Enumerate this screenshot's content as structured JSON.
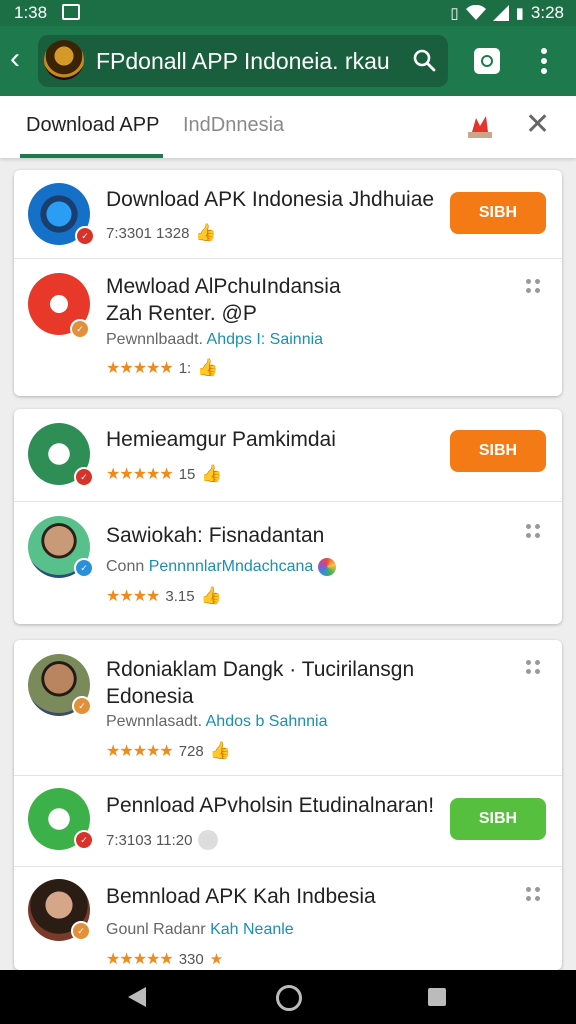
{
  "status_bar": {
    "time_left": "1:38",
    "time_right": "3:28",
    "icons": [
      "gallery-icon",
      "vibrate-icon",
      "wifi-icon",
      "signal-icon",
      "battery-icon"
    ]
  },
  "app_bar": {
    "search_text": "FPdonall APP Indoneia. rkau",
    "icons": [
      "back-arrow-icon",
      "app-logo",
      "search-icon",
      "apps-icon",
      "more-vert-icon"
    ]
  },
  "tabs": {
    "active": "Download APP",
    "inactive": "IndDnnesia"
  },
  "cards": [
    {
      "items": [
        {
          "title": "Download APK Indonesia Jhdhuiae",
          "meta_text": "7:3301 1328",
          "button": "SIBH",
          "avatar": "phone-app-icon"
        },
        {
          "title_line1": "Mewload AlPchuIndansia",
          "title_line2": "Zah Renter. @P",
          "sub_prefix": "Pewnnlbaadt.",
          "sub_link": "Ahdps I: Sainnia",
          "rating": "1:",
          "avatar": "red-d-app-icon"
        }
      ]
    },
    {
      "items": [
        {
          "title": "Hemieamgur Pamkimdai",
          "rating": "15",
          "button": "SIBH",
          "avatar": "green-box-app-icon"
        },
        {
          "title": "Sawiokah: Fisnadantan",
          "sub_prefix": "Conn",
          "sub_link": "PennnnlarMndachcana",
          "rating": "3.15",
          "avatar": "man-portrait"
        }
      ]
    },
    {
      "items": [
        {
          "title_line1": "Rdoniaklam Dangk · Tucirilansgn",
          "title_line2": "Edonesia",
          "sub_prefix": "Pewnnlasadt.",
          "sub_link": "Ahdos b Sahnnia",
          "rating": "728",
          "avatar": "man-portrait-2"
        },
        {
          "title": "Pennload APvholsin Etudinalnaran!",
          "meta_text": "7:3103 11:20",
          "button": "SIBH",
          "avatar": "green-box-app-icon-2"
        },
        {
          "title": "Bemnload APK Kah Indbesia",
          "sub_prefix": "Gounl Radanr",
          "sub_link": "Kah Neanle",
          "rating": "330",
          "avatar": "woman-portrait"
        }
      ]
    }
  ],
  "colors": {
    "primary": "#1e7a4c",
    "status_bar": "#1c6f45",
    "orange_button": "#f47a16",
    "green_button": "#56c03e",
    "star": "#f08a1a",
    "link": "#1a8fb0"
  }
}
